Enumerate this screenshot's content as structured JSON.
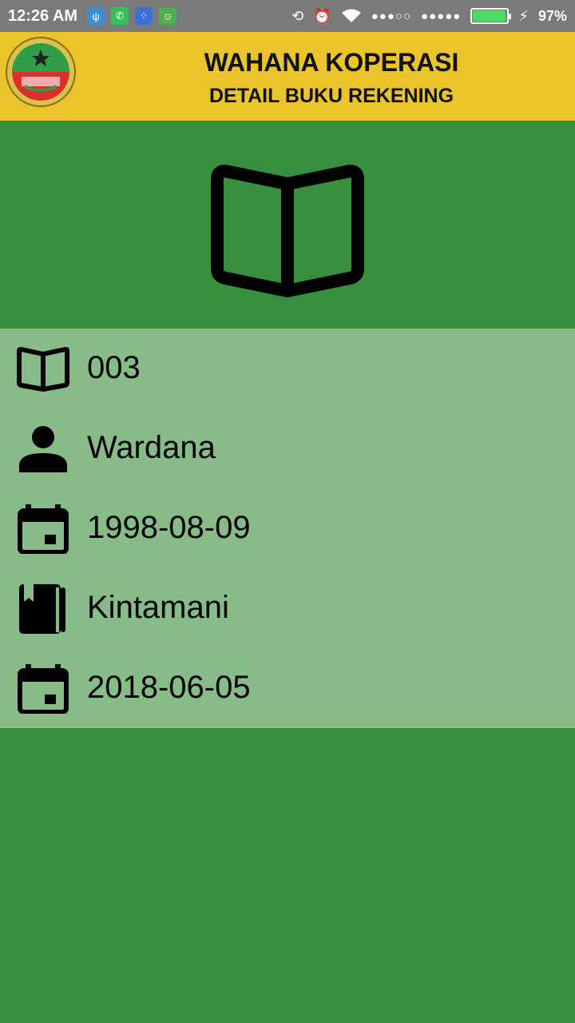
{
  "status_bar": {
    "time": "12:26 AM",
    "signal_dots_1": "●●●○○",
    "signal_dots_2": "●●●●●",
    "battery_level": 0.97,
    "battery_text": "97%"
  },
  "app_bar": {
    "title": "WAHANA KOPERASI",
    "subtitle": "DETAIL BUKU REKENING"
  },
  "details": [
    {
      "icon": "open-book-icon",
      "value": "003"
    },
    {
      "icon": "person-icon",
      "value": "Wardana"
    },
    {
      "icon": "calendar-icon",
      "value": "1998-08-09"
    },
    {
      "icon": "book-bookmark-icon",
      "value": "Kintamani"
    },
    {
      "icon": "calendar-icon",
      "value": "2018-06-05"
    }
  ],
  "colors": {
    "status_bar": "#7a7a7a",
    "app_bar": "#ebc32b",
    "background": "#388e3c",
    "details_panel": "#87bc89"
  }
}
